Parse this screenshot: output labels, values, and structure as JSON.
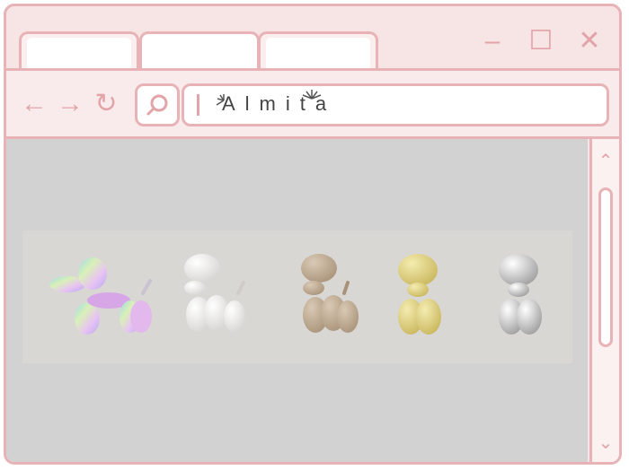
{
  "browser": {
    "tabs": [
      {
        "label": ""
      },
      {
        "label": ""
      },
      {
        "label": ""
      }
    ],
    "window_controls": [
      "minimize-icon",
      "maximize-icon",
      "close-icon"
    ],
    "nav": [
      "back-icon",
      "forward-icon",
      "reload-icon"
    ],
    "search_icon": "search-icon",
    "address_text": "Almita",
    "accent_color": "#e7b3b6"
  },
  "page": {
    "products": [
      {
        "name": "",
        "finish": "iridescent"
      },
      {
        "name": "",
        "finish": "white"
      },
      {
        "name": "",
        "finish": "wood"
      },
      {
        "name": "",
        "finish": "gold"
      },
      {
        "name": "",
        "finish": "silver"
      }
    ]
  }
}
